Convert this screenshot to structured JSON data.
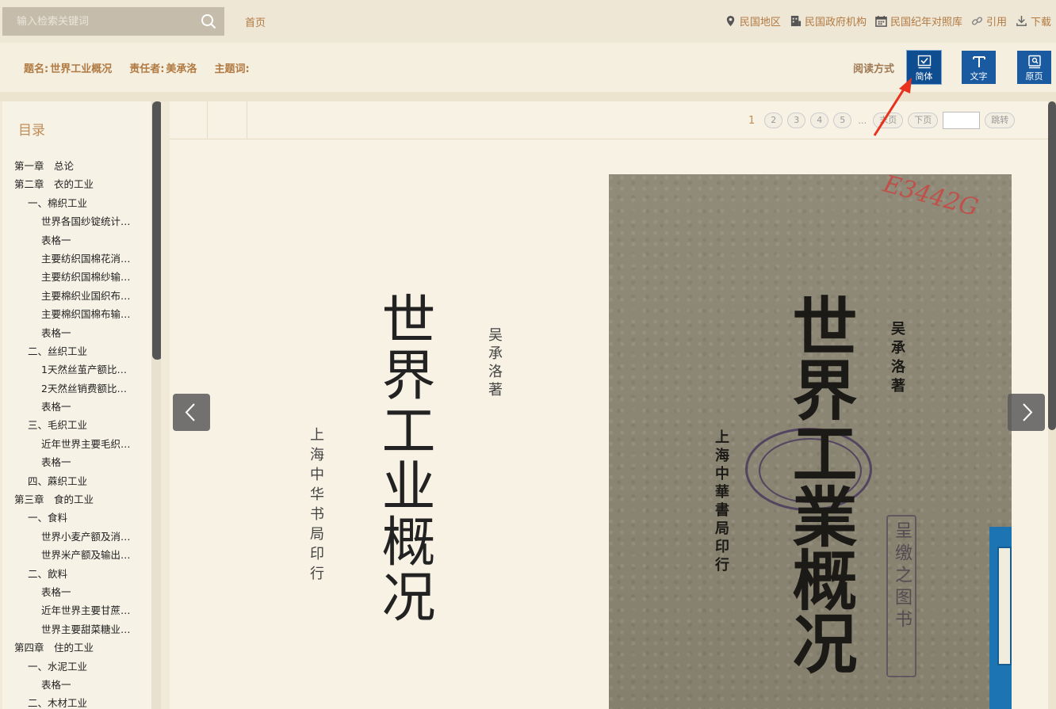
{
  "search": {
    "placeholder": "输入检索关键词"
  },
  "nav": {
    "home": "首页"
  },
  "top_links": [
    {
      "label": "民国地区",
      "icon": "location-icon"
    },
    {
      "label": "民国政府机构",
      "icon": "building-icon"
    },
    {
      "label": "民国纪年对照库",
      "icon": "calendar-icon"
    },
    {
      "label": "引用",
      "icon": "link-icon"
    },
    {
      "label": "下载",
      "icon": "download-icon"
    }
  ],
  "meta": {
    "title_label": "题名:",
    "title_value": "世界工业概况",
    "author_label": "责任者:",
    "author_value": "美承洛",
    "subject_label": "主题词:",
    "subject_value": ""
  },
  "reading": {
    "label": "阅读方式",
    "modes": [
      {
        "label": "简体",
        "icon": "check-page-icon",
        "active": true
      },
      {
        "label": "文字",
        "icon": "text-icon",
        "active": false
      },
      {
        "label": "原页",
        "icon": "original-page-icon",
        "active": false
      }
    ]
  },
  "toc": {
    "title": "目录",
    "items": [
      {
        "text": "第一章　总论",
        "level": 1
      },
      {
        "text": "第二章　衣的工业",
        "level": 1
      },
      {
        "text": "一、棉织工业",
        "level": 2
      },
      {
        "text": "世界各国纱锭统计…",
        "level": 3
      },
      {
        "text": "表格一",
        "level": 3
      },
      {
        "text": "主要纺织国棉花消…",
        "level": 3
      },
      {
        "text": "主要纺织国棉纱输…",
        "level": 3
      },
      {
        "text": "主要棉织业国织布…",
        "level": 3
      },
      {
        "text": "主要棉织国棉布输…",
        "level": 3
      },
      {
        "text": "表格一",
        "level": 3
      },
      {
        "text": "二、丝织工业",
        "level": 2
      },
      {
        "text": "1天然丝茧产额比…",
        "level": 3
      },
      {
        "text": "2天然丝销费额比…",
        "level": 3
      },
      {
        "text": "表格一",
        "level": 3
      },
      {
        "text": "三、毛织工业",
        "level": 2
      },
      {
        "text": "近年世界主要毛织…",
        "level": 3
      },
      {
        "text": "表格一",
        "level": 3
      },
      {
        "text": "四、蔴织工业",
        "level": 2
      },
      {
        "text": "第三章　食的工业",
        "level": 1
      },
      {
        "text": "一、食料",
        "level": 2
      },
      {
        "text": "世界小麦产额及消…",
        "level": 3
      },
      {
        "text": "世界米产额及输出…",
        "level": 3
      },
      {
        "text": "二、飲料",
        "level": 2
      },
      {
        "text": "表格一",
        "level": 3
      },
      {
        "text": "近年世界主要甘蔗…",
        "level": 3
      },
      {
        "text": "世界主要甜菜糖业…",
        "level": 3
      },
      {
        "text": "第四章　住的工业",
        "level": 1
      },
      {
        "text": "一、水泥工业",
        "level": 2
      },
      {
        "text": "表格一",
        "level": 3
      },
      {
        "text": "二、木材工业",
        "level": 2
      }
    ]
  },
  "pager": {
    "current": "1",
    "pages": [
      "2",
      "3",
      "4",
      "5"
    ],
    "ellipsis": "…",
    "last": "末页",
    "next": "下页",
    "jump_value": "",
    "jump": "跳转"
  },
  "page_text": {
    "title": "世界工业概况",
    "author": "吴承洛著",
    "publisher": "上海中华书局印行"
  },
  "scan_text": {
    "title": "世界工業概况",
    "author": "吴承洛著",
    "publisher": "上海中華書局印行",
    "handwriting": "E3442G",
    "stamp_chars": "呈缴之图书"
  }
}
